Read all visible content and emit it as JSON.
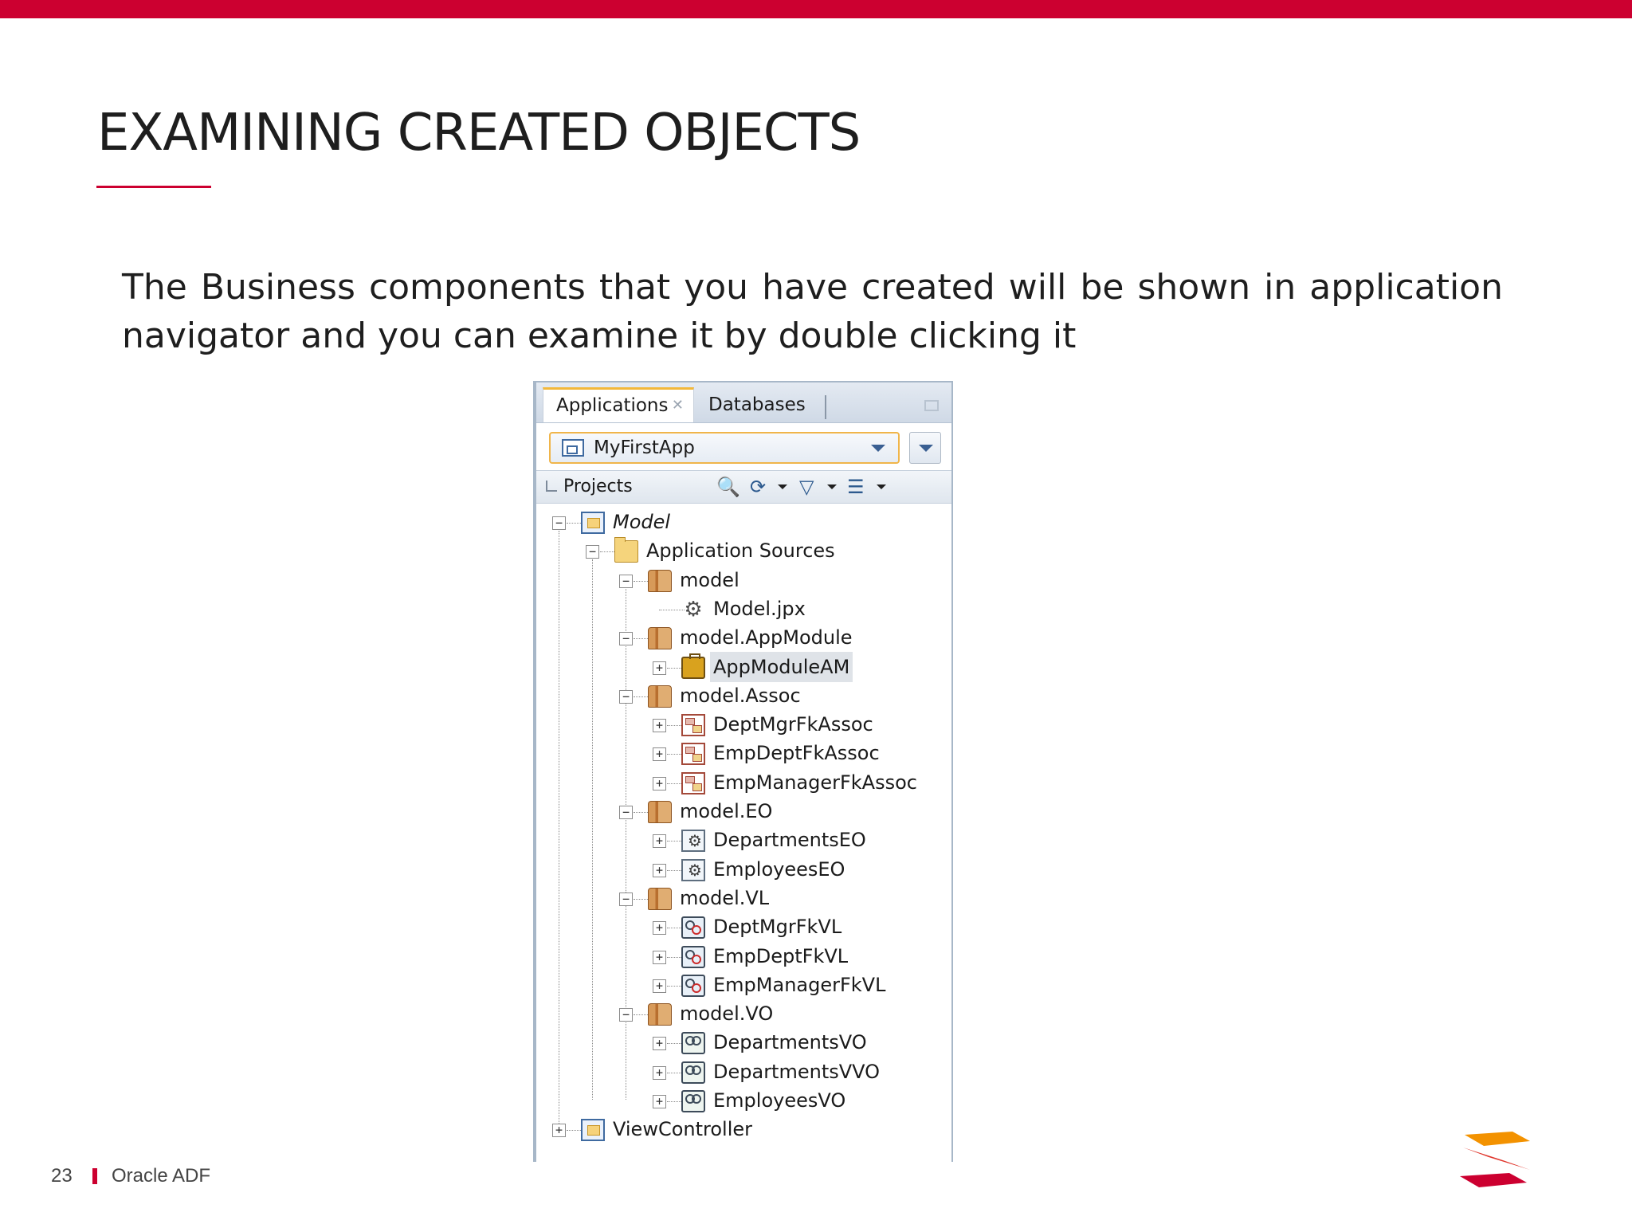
{
  "slide": {
    "title": "EXAMINING CREATED OBJECTS",
    "body": "The Business  components that you have created will be shown in application navigator and you can examine it by double clicking it",
    "page_number": "23",
    "footer_label": "Oracle ADF"
  },
  "navigator": {
    "tabs": [
      {
        "label": "Applications",
        "active": true
      },
      {
        "label": "Databases",
        "active": false
      }
    ],
    "application_selector": {
      "value": "MyFirstApp"
    },
    "projects_label": "Projects",
    "tree": [
      {
        "label": "Model",
        "icon": "project-icon",
        "level": 0,
        "expanded": true,
        "italic": true
      },
      {
        "label": "Application Sources",
        "icon": "folder-icon",
        "level": 1,
        "expanded": true
      },
      {
        "label": "model",
        "icon": "package-icon",
        "level": 2,
        "expanded": true
      },
      {
        "label": "Model.jpx",
        "icon": "gears-icon",
        "level": 3,
        "leaf": true
      },
      {
        "label": "model.AppModule",
        "icon": "package-icon",
        "level": 2,
        "expanded": true
      },
      {
        "label": "AppModuleAM",
        "icon": "briefcase-icon",
        "level": 3,
        "expanded": false,
        "selected": true
      },
      {
        "label": "model.Assoc",
        "icon": "package-icon",
        "level": 2,
        "expanded": true
      },
      {
        "label": "DeptMgrFkAssoc",
        "icon": "association-icon",
        "level": 3,
        "expanded": false
      },
      {
        "label": "EmpDeptFkAssoc",
        "icon": "association-icon",
        "level": 3,
        "expanded": false
      },
      {
        "label": "EmpManagerFkAssoc",
        "icon": "association-icon",
        "level": 3,
        "expanded": false
      },
      {
        "label": "model.EO",
        "icon": "package-icon",
        "level": 2,
        "expanded": true
      },
      {
        "label": "DepartmentsEO",
        "icon": "entity-icon",
        "level": 3,
        "expanded": false
      },
      {
        "label": "EmployeesEO",
        "icon": "entity-icon",
        "level": 3,
        "expanded": false
      },
      {
        "label": "model.VL",
        "icon": "package-icon",
        "level": 2,
        "expanded": true
      },
      {
        "label": "DeptMgrFkVL",
        "icon": "viewlink-icon",
        "level": 3,
        "expanded": false
      },
      {
        "label": "EmpDeptFkVL",
        "icon": "viewlink-icon",
        "level": 3,
        "expanded": false
      },
      {
        "label": "EmpManagerFkVL",
        "icon": "viewlink-icon",
        "level": 3,
        "expanded": false
      },
      {
        "label": "model.VO",
        "icon": "package-icon",
        "level": 2,
        "expanded": true
      },
      {
        "label": "DepartmentsVO",
        "icon": "viewobject-icon",
        "level": 3,
        "expanded": false
      },
      {
        "label": "DepartmentsVVO",
        "icon": "viewobject-icon",
        "level": 3,
        "expanded": false
      },
      {
        "label": "EmployeesVO",
        "icon": "viewobject-icon",
        "level": 3,
        "expanded": false
      },
      {
        "label": "ViewController",
        "icon": "project-icon",
        "level": 0,
        "expanded": false
      }
    ]
  },
  "colors": {
    "accent": "#cc0030",
    "tab_highlight": "#f3b83a",
    "logo_orange": "#f39200"
  }
}
